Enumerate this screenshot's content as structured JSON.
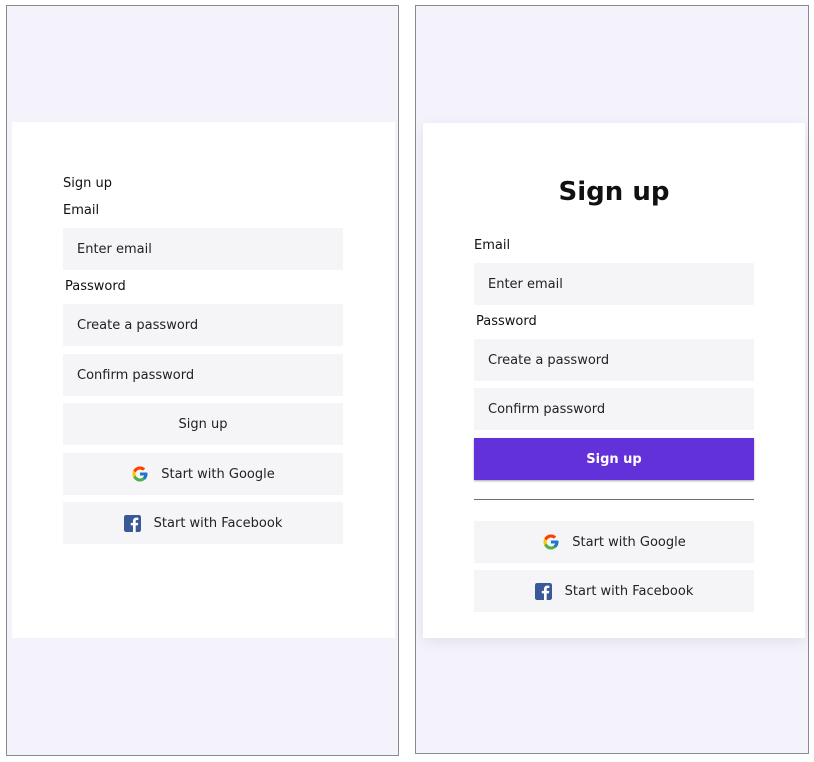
{
  "left": {
    "title": "Sign up",
    "email_label": "Email",
    "email_placeholder": "Enter email",
    "password_label": "Password",
    "create_password_placeholder": "Create a password",
    "confirm_password_placeholder": "Confirm password",
    "signup_button": "Sign up",
    "google_button": "Start with Google",
    "facebook_button": "Start with Facebook"
  },
  "right": {
    "title": "Sign up",
    "email_label": "Email",
    "email_placeholder": "Enter email",
    "password_label": "Password",
    "create_password_placeholder": "Create a password",
    "confirm_password_placeholder": "Confirm password",
    "signup_button": "Sign up",
    "google_button": "Start with Google",
    "facebook_button": "Start with Facebook"
  },
  "colors": {
    "background": "#f4f3fc",
    "card": "#ffffff",
    "field": "#f5f5f7",
    "primary_button": "#6331d9",
    "divider": "#6d6d6d",
    "facebook_icon": "#3b5998"
  },
  "icons": {
    "google": "google-icon",
    "facebook": "facebook-icon"
  }
}
